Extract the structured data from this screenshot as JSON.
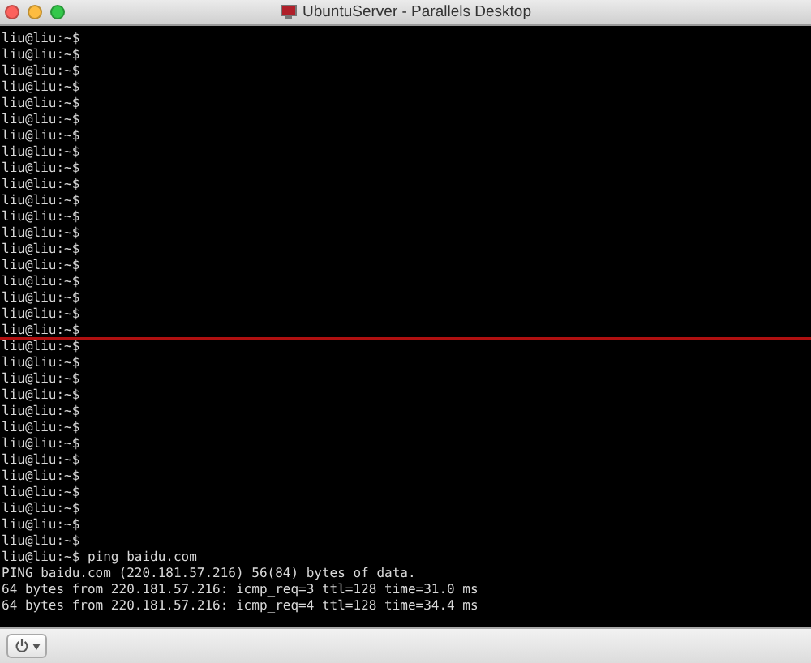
{
  "window": {
    "title": "UbuntuServer - Parallels Desktop"
  },
  "terminal": {
    "lines": [
      {
        "text": "liu@liu:~$",
        "marked": false
      },
      {
        "text": "liu@liu:~$",
        "marked": false
      },
      {
        "text": "liu@liu:~$",
        "marked": false
      },
      {
        "text": "liu@liu:~$",
        "marked": false
      },
      {
        "text": "liu@liu:~$",
        "marked": false
      },
      {
        "text": "liu@liu:~$",
        "marked": false
      },
      {
        "text": "liu@liu:~$",
        "marked": false
      },
      {
        "text": "liu@liu:~$",
        "marked": false
      },
      {
        "text": "liu@liu:~$",
        "marked": false
      },
      {
        "text": "liu@liu:~$",
        "marked": false
      },
      {
        "text": "liu@liu:~$",
        "marked": false
      },
      {
        "text": "liu@liu:~$",
        "marked": false
      },
      {
        "text": "liu@liu:~$",
        "marked": false
      },
      {
        "text": "liu@liu:~$",
        "marked": false
      },
      {
        "text": "liu@liu:~$",
        "marked": false
      },
      {
        "text": "liu@liu:~$",
        "marked": false
      },
      {
        "text": "liu@liu:~$",
        "marked": false
      },
      {
        "text": "liu@liu:~$",
        "marked": false
      },
      {
        "text": "liu@liu:~$",
        "marked": true
      },
      {
        "text": "liu@liu:~$",
        "marked": false
      },
      {
        "text": "liu@liu:~$",
        "marked": false
      },
      {
        "text": "liu@liu:~$",
        "marked": false
      },
      {
        "text": "liu@liu:~$",
        "marked": false
      },
      {
        "text": "liu@liu:~$",
        "marked": false
      },
      {
        "text": "liu@liu:~$",
        "marked": false
      },
      {
        "text": "liu@liu:~$",
        "marked": false
      },
      {
        "text": "liu@liu:~$",
        "marked": false
      },
      {
        "text": "liu@liu:~$",
        "marked": false
      },
      {
        "text": "liu@liu:~$",
        "marked": false
      },
      {
        "text": "liu@liu:~$",
        "marked": false
      },
      {
        "text": "liu@liu:~$",
        "marked": false
      },
      {
        "text": "liu@liu:~$",
        "marked": false
      },
      {
        "text": "liu@liu:~$ ping baidu.com",
        "marked": false
      },
      {
        "text": "PING baidu.com (220.181.57.216) 56(84) bytes of data.",
        "marked": false
      },
      {
        "text": "64 bytes from 220.181.57.216: icmp_req=3 ttl=128 time=31.0 ms",
        "marked": false
      },
      {
        "text": "64 bytes from 220.181.57.216: icmp_req=4 ttl=128 time=34.4 ms",
        "marked": false
      }
    ]
  }
}
